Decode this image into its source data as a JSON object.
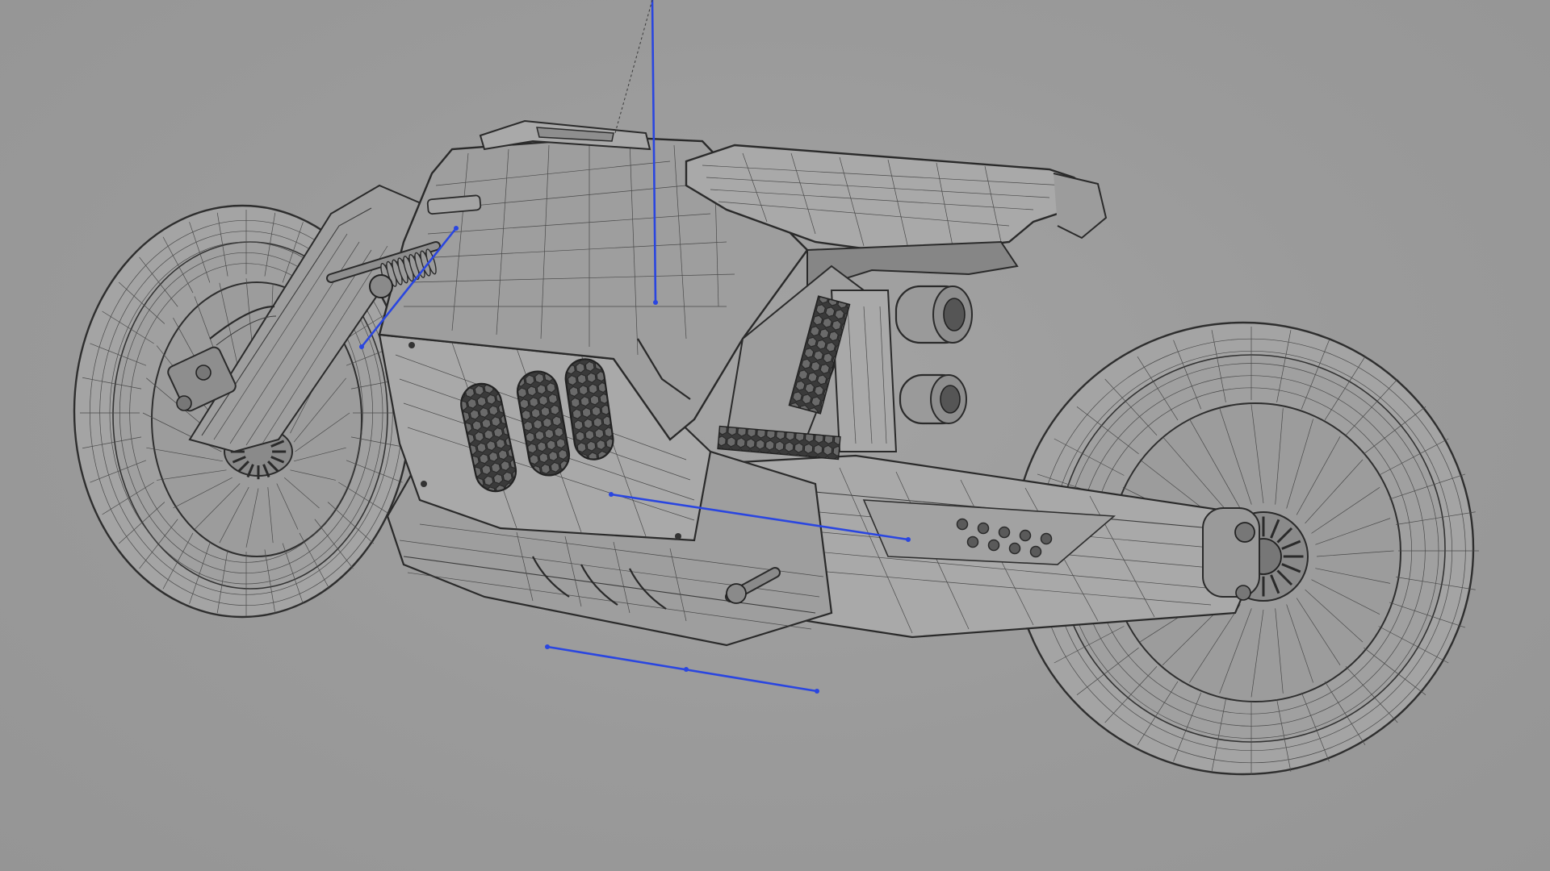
{
  "viewport": {
    "background": "#9a9a9a",
    "mesh_color": "#3c3c3c",
    "gizmo_color": "#2a46e0",
    "object": "motorcycle-wireframe-model"
  }
}
